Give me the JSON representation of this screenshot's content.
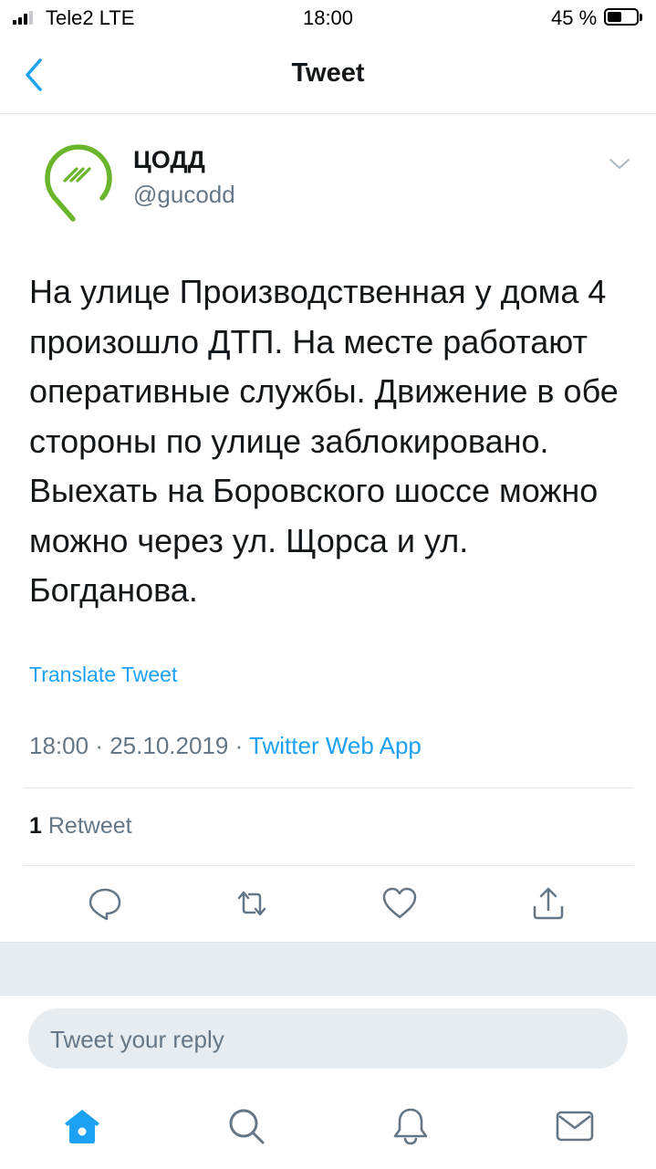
{
  "status_bar": {
    "carrier": "Tele2 LTE",
    "time": "18:00",
    "battery_percent": "45 %",
    "battery_level": 0.45
  },
  "header": {
    "title": "Tweet",
    "back_icon": "chevron-left-icon"
  },
  "tweet": {
    "author_name": "ЦОДД",
    "author_handle": "@gucodd",
    "avatar_icon": "map-pin-logo",
    "menu_icon": "chevron-down-icon",
    "text": "На улице Производственная у дома 4 произошло ДТП. На месте работают оперативные службы. Движение в обе стороны по улице заблокировано. Выехать на Боровского шоссе можно можно через ул. Щорса и ул. Богданова.",
    "translate_label": "Translate Tweet",
    "time": "18:00",
    "date": "25.10.2019",
    "separator": "·",
    "source": "Twitter Web App",
    "retweet_count": "1",
    "retweet_label": "Retweet"
  },
  "actions": [
    {
      "icon": "reply-icon"
    },
    {
      "icon": "retweet-icon"
    },
    {
      "icon": "like-icon"
    },
    {
      "icon": "share-icon"
    }
  ],
  "reply": {
    "placeholder": "Tweet your reply"
  },
  "tab_bar": [
    {
      "icon": "home-icon",
      "active": true
    },
    {
      "icon": "search-icon",
      "active": false
    },
    {
      "icon": "notifications-icon",
      "active": false
    },
    {
      "icon": "messages-icon",
      "active": false
    }
  ],
  "colors": {
    "accent": "#1da1f2",
    "secondary_text": "#657786",
    "logo_green": "#6ab52b"
  }
}
